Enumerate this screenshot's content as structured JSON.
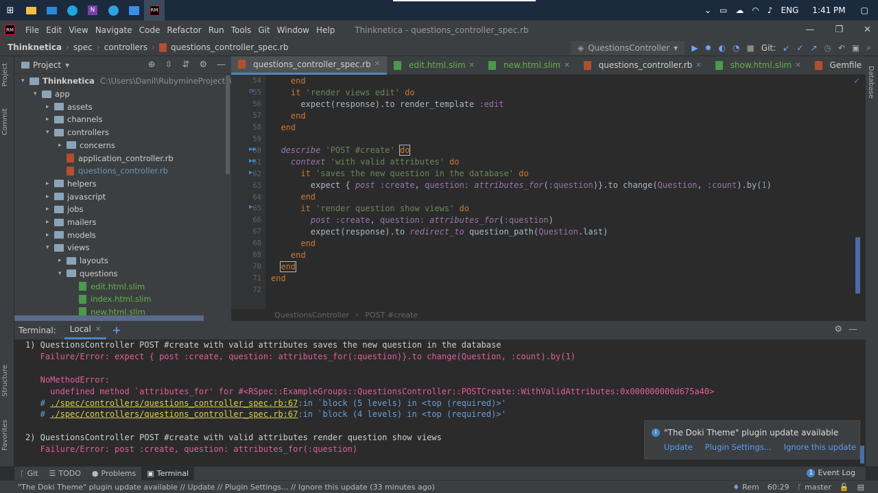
{
  "taskbar": {
    "apps": [
      "start-icon",
      "file-explorer-icon",
      "mail-icon",
      "edge-icon",
      "onenote-icon",
      "telegram-icon",
      "photos-icon",
      "rubymine-icon"
    ],
    "tray": {
      "lang": "ENG",
      "time": "1:41 PM"
    }
  },
  "menubar": {
    "items": [
      "File",
      "Edit",
      "View",
      "Navigate",
      "Code",
      "Refactor",
      "Run",
      "Tools",
      "Git",
      "Window",
      "Help"
    ],
    "title": "Thinknetica - questions_controller_spec.rb"
  },
  "navbar": {
    "crumbs": [
      "Thinknetica",
      "spec",
      "controllers",
      "questions_controller_spec.rb"
    ],
    "run_config": "QuestionsController",
    "git_label": "Git:"
  },
  "left_strip": {
    "project": "Project",
    "commit": "Commit",
    "structure": "Structure",
    "favorites": "Favorites"
  },
  "right_strip": {
    "database": "Database"
  },
  "project": {
    "header": "Project",
    "root_name": "Thinknetica",
    "root_path": "C:\\Users\\Danil\\RubymineProjects\\Thinkne",
    "tree": [
      {
        "label": "app",
        "type": "folder",
        "arrow": "▾",
        "indent": 1
      },
      {
        "label": "assets",
        "type": "folder",
        "arrow": "▸",
        "indent": 2
      },
      {
        "label": "channels",
        "type": "folder",
        "arrow": "▸",
        "indent": 2
      },
      {
        "label": "controllers",
        "type": "folder",
        "arrow": "▾",
        "indent": 2
      },
      {
        "label": "concerns",
        "type": "folder",
        "arrow": "▸",
        "indent": 3
      },
      {
        "label": "application_controller.rb",
        "type": "rb",
        "arrow": "",
        "indent": 3
      },
      {
        "label": "questions_controller.rb",
        "type": "rb-blue",
        "arrow": "",
        "indent": 3
      },
      {
        "label": "helpers",
        "type": "folder",
        "arrow": "▸",
        "indent": 2
      },
      {
        "label": "javascript",
        "type": "folder",
        "arrow": "▸",
        "indent": 2
      },
      {
        "label": "jobs",
        "type": "folder",
        "arrow": "▸",
        "indent": 2
      },
      {
        "label": "mailers",
        "type": "folder",
        "arrow": "▸",
        "indent": 2
      },
      {
        "label": "models",
        "type": "folder",
        "arrow": "▸",
        "indent": 2
      },
      {
        "label": "views",
        "type": "folder",
        "arrow": "▾",
        "indent": 2
      },
      {
        "label": "layouts",
        "type": "folder",
        "arrow": "▸",
        "indent": 3
      },
      {
        "label": "questions",
        "type": "folder",
        "arrow": "▾",
        "indent": 3
      },
      {
        "label": "edit.html.slim",
        "type": "slim",
        "arrow": "",
        "indent": 4
      },
      {
        "label": "index.html.slim",
        "type": "slim",
        "arrow": "",
        "indent": 4
      },
      {
        "label": "new.html.slim",
        "type": "slim",
        "arrow": "",
        "indent": 4
      }
    ]
  },
  "tabs": [
    {
      "label": "questions_controller_spec.rb",
      "icon": "rb"
    },
    {
      "label": "edit.html.slim",
      "icon": "slim"
    },
    {
      "label": "new.html.slim",
      "icon": "slim"
    },
    {
      "label": "questions_controller.rb",
      "icon": "rb"
    },
    {
      "label": "show.html.slim",
      "icon": "slim"
    },
    {
      "label": "Gemfile",
      "icon": "rb"
    }
  ],
  "editor": {
    "line_numbers": [
      "54",
      "55",
      "56",
      "57",
      "58",
      "59",
      "60",
      "61",
      "62",
      "63",
      "64",
      "65",
      "66",
      "67",
      "68",
      "69",
      "70",
      "71",
      "72"
    ],
    "breadcrumb": [
      "QuestionsController",
      "POST #create"
    ]
  },
  "terminal": {
    "label": "Terminal:",
    "tab": "Local",
    "lines": [
      {
        "text": "1) QuestionsController POST #create with valid attributes saves the new question in the database",
        "cls": ""
      },
      {
        "text": "   Failure/Error: expect { post :create, question: attributes_for(:question)}.to change(Question, :count).by(1)",
        "cls": "err"
      },
      {
        "text": "",
        "cls": ""
      },
      {
        "text": "   NoMethodError:",
        "cls": "err"
      },
      {
        "text": "     undefined method `attributes_for' for #<RSpec::ExampleGroups::QuestionsController::POSTCreate::WithValidAttributes:0x000000000d675a40>",
        "cls": "err"
      },
      {
        "text": "",
        "cls": "link1"
      },
      {
        "text": "",
        "cls": "link2"
      },
      {
        "text": "",
        "cls": ""
      },
      {
        "text": "2) QuestionsController POST #create with valid attributes render question show views",
        "cls": ""
      },
      {
        "text": "   Failure/Error: post :create, question: attributes_for(:question)",
        "cls": "err"
      }
    ],
    "trace1_prefix": "   # ",
    "trace1_link": "./spec/controllers/questions_controller_spec.rb:67",
    "trace1_rest": ":in `block (5 levels) in <top (required)>'",
    "trace2_prefix": "   # ",
    "trace2_link": "./spec/controllers/questions_controller_spec.rb:67",
    "trace2_rest": ":in `block (4 levels) in <top (required)>'"
  },
  "notification": {
    "title": "\"The Doki Theme\" plugin update available",
    "actions": [
      "Update",
      "Plugin Settings...",
      "Ignore this update"
    ]
  },
  "tool_tabs": [
    "Git",
    "TODO",
    "Problems",
    "Terminal"
  ],
  "event_log": "Event Log",
  "statusbar": {
    "message": "\"The Doki Theme\" plugin update available // Update // Plugin Settings... // Ignore this update (33 minutes ago)",
    "rem": "Rem",
    "position": "60:29",
    "branch": "master"
  }
}
